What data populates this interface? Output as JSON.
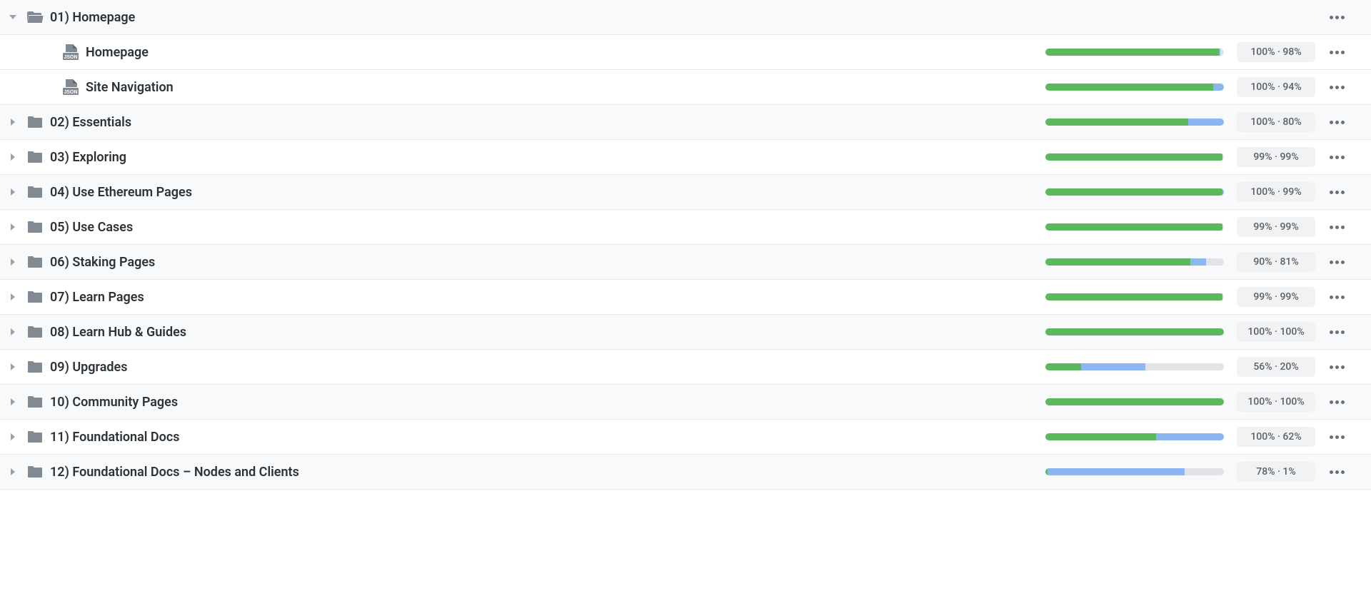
{
  "rows": [
    {
      "type": "folder",
      "expanded": true,
      "name": "01) Homepage",
      "progress": null,
      "stats": null
    },
    {
      "type": "file",
      "indent": true,
      "name": "Homepage",
      "progress": {
        "green": 97,
        "blue": 1
      },
      "stats": "100% · 98%"
    },
    {
      "type": "file",
      "indent": true,
      "name": "Site Navigation",
      "progress": {
        "green": 94,
        "blue": 6
      },
      "stats": "100% · 94%"
    },
    {
      "type": "folder",
      "expanded": false,
      "name": "02) Essentials",
      "progress": {
        "green": 80,
        "blue": 20
      },
      "stats": "100% · 80%"
    },
    {
      "type": "folder",
      "expanded": false,
      "name": "03) Exploring",
      "progress": {
        "green": 99,
        "blue": 0
      },
      "stats": "99% · 99%"
    },
    {
      "type": "folder",
      "expanded": false,
      "name": "04) Use Ethereum Pages",
      "progress": {
        "green": 99,
        "blue": 1
      },
      "stats": "100% · 99%"
    },
    {
      "type": "folder",
      "expanded": false,
      "name": "05) Use Cases",
      "progress": {
        "green": 99,
        "blue": 0
      },
      "stats": "99% · 99%"
    },
    {
      "type": "folder",
      "expanded": false,
      "name": "06) Staking Pages",
      "progress": {
        "green": 81,
        "blue": 9
      },
      "stats": "90% · 81%"
    },
    {
      "type": "folder",
      "expanded": false,
      "name": "07) Learn Pages",
      "progress": {
        "green": 99,
        "blue": 0
      },
      "stats": "99% · 99%"
    },
    {
      "type": "folder",
      "expanded": false,
      "name": "08) Learn Hub & Guides",
      "progress": {
        "green": 100,
        "blue": 0
      },
      "stats": "100% · 100%"
    },
    {
      "type": "folder",
      "expanded": false,
      "name": "09) Upgrades",
      "progress": {
        "green": 20,
        "blue": 36
      },
      "stats": "56% · 20%"
    },
    {
      "type": "folder",
      "expanded": false,
      "name": "10) Community Pages",
      "progress": {
        "green": 100,
        "blue": 0
      },
      "stats": "100% · 100%"
    },
    {
      "type": "folder",
      "expanded": false,
      "name": "11) Foundational Docs",
      "progress": {
        "green": 62,
        "blue": 38
      },
      "stats": "100% · 62%"
    },
    {
      "type": "folder",
      "expanded": false,
      "name": "12) Foundational Docs – Nodes and Clients",
      "progress": {
        "green": 1,
        "blue": 77
      },
      "stats": "78% · 1%"
    }
  ]
}
